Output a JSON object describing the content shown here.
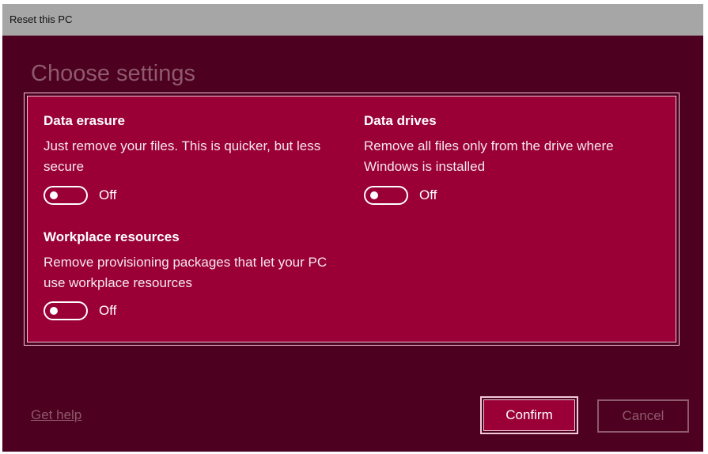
{
  "window": {
    "title": "Reset this PC"
  },
  "page": {
    "heading": "Choose settings"
  },
  "settings": {
    "data_erasure": {
      "title": "Data erasure",
      "description": "Just remove your files. This is quicker, but less secure",
      "toggle_state": "Off"
    },
    "data_drives": {
      "title": "Data drives",
      "description": "Remove all files only from the drive where Windows is installed",
      "toggle_state": "Off"
    },
    "workplace_resources": {
      "title": "Workplace resources",
      "description": "Remove provisioning packages that let your PC use workplace resources",
      "toggle_state": "Off"
    }
  },
  "footer": {
    "help_link": "Get help",
    "confirm_label": "Confirm",
    "cancel_label": "Cancel"
  },
  "colors": {
    "background": "#4d0020",
    "panel": "#9a0036",
    "titlebar": "#a6a6a6",
    "border": "#f2c9d6",
    "muted_text": "#8e5a6c"
  }
}
